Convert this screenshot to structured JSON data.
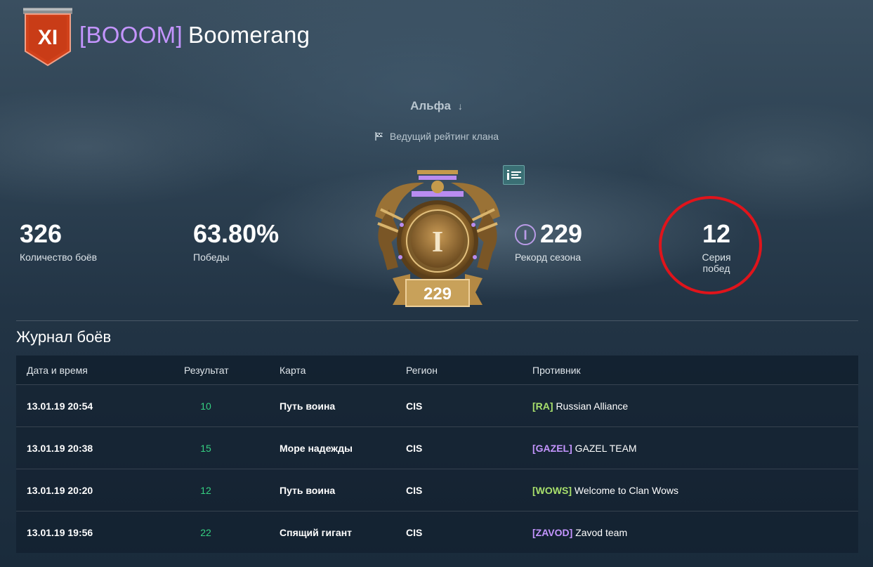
{
  "clan": {
    "division_label": "XI",
    "tag": "[BOOOM]",
    "name": "Boomerang"
  },
  "league": {
    "name": "Альфа",
    "arrow": "↓",
    "rating_note": "Ведущий рейтинг клана"
  },
  "stats": {
    "battles": {
      "value": "326",
      "label": "Количество боёв"
    },
    "wins": {
      "value": "63.80%",
      "label": "Победы"
    },
    "record": {
      "league_numeral": "I",
      "value": "229",
      "label": "Рекорд сезона"
    },
    "streak": {
      "value": "12",
      "label": "Серия побед"
    }
  },
  "emblem": {
    "league_numeral": "I",
    "rating": "229"
  },
  "battle_log": {
    "title": "Журнал боёв",
    "columns": [
      "Дата и время",
      "Результат",
      "Карта",
      "Регион",
      "Противник"
    ],
    "rows": [
      {
        "date": "13.01.19 20:54",
        "result": "10",
        "map": "Путь воина",
        "region": "CIS",
        "opp_tag": "[RA]",
        "opp_tag_color": "#a8e06c",
        "opp_name": "Russian Alliance"
      },
      {
        "date": "13.01.19 20:38",
        "result": "15",
        "map": "Море надежды",
        "region": "CIS",
        "opp_tag": "[GAZEL]",
        "opp_tag_color": "#c495ff",
        "opp_name": "GAZEL TEAM"
      },
      {
        "date": "13.01.19 20:20",
        "result": "12",
        "map": "Путь воина",
        "region": "CIS",
        "opp_tag": "[WOWS]",
        "opp_tag_color": "#a8e06c",
        "opp_name": "Welcome to Clan Wows"
      },
      {
        "date": "13.01.19 19:56",
        "result": "22",
        "map": "Спящий гигант",
        "region": "CIS",
        "opp_tag": "[ZAVOD]",
        "opp_tag_color": "#c495ff",
        "opp_name": "Zavod team"
      }
    ]
  },
  "colors": {
    "clan_tag": "#c495ff",
    "win_result": "#35d081",
    "highlight": "#e0141b",
    "badge": "#d2421b"
  }
}
